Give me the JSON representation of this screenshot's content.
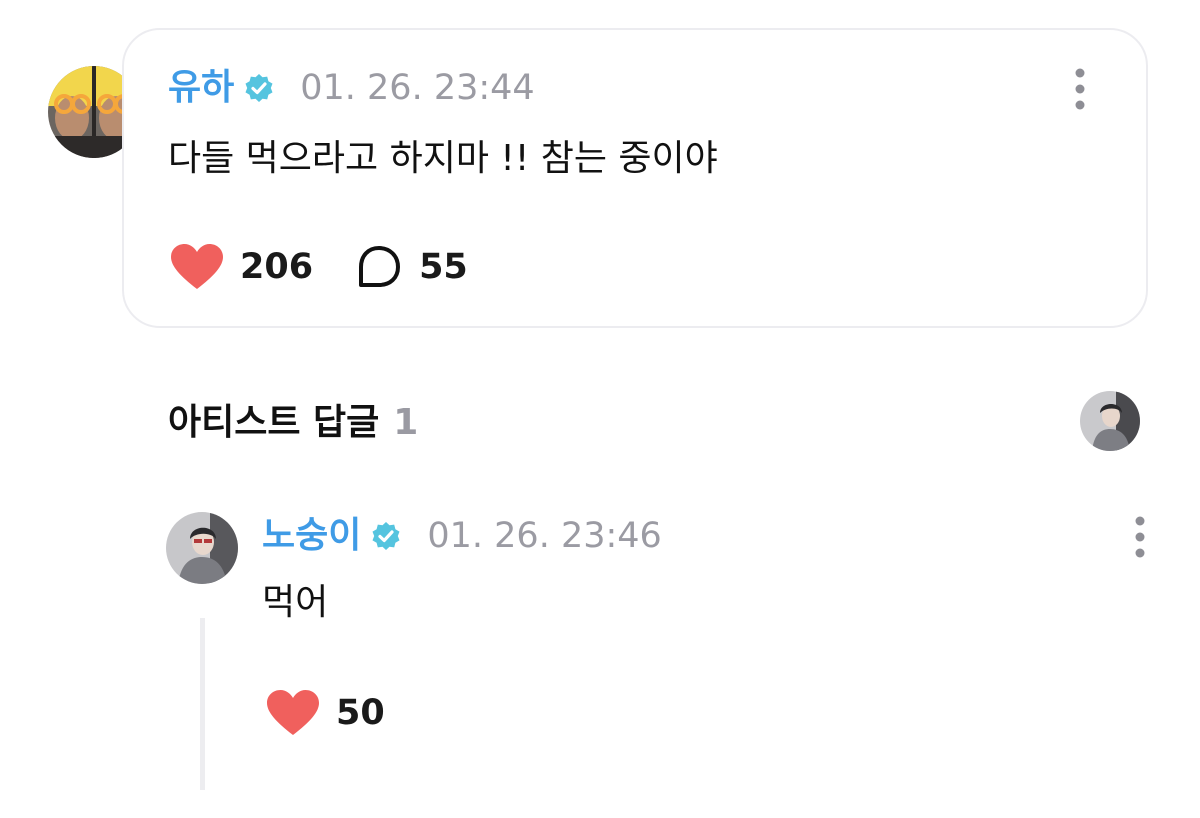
{
  "post": {
    "author": "유하",
    "timestamp": "01. 26. 23:44",
    "text": "다들 먹으라고 하지마 !! 참는 중이야",
    "likes": "206",
    "comments": "55"
  },
  "artist_replies": {
    "title": "아티스트 답글",
    "count": "1"
  },
  "reply": {
    "author": "노숭이",
    "timestamp": "01. 26. 23:46",
    "text": "먹어",
    "likes": "50"
  },
  "icons": {
    "verified": "verified-badge-icon",
    "more": "more-vertical-icon",
    "heart": "heart-icon",
    "comment": "comment-bubble-icon"
  },
  "colors": {
    "author_name": "#3f9be6",
    "verified_badge": "#55c4df",
    "heart": "#f0605d",
    "timestamp": "#9b9ba3",
    "card_border": "#ececf0"
  }
}
